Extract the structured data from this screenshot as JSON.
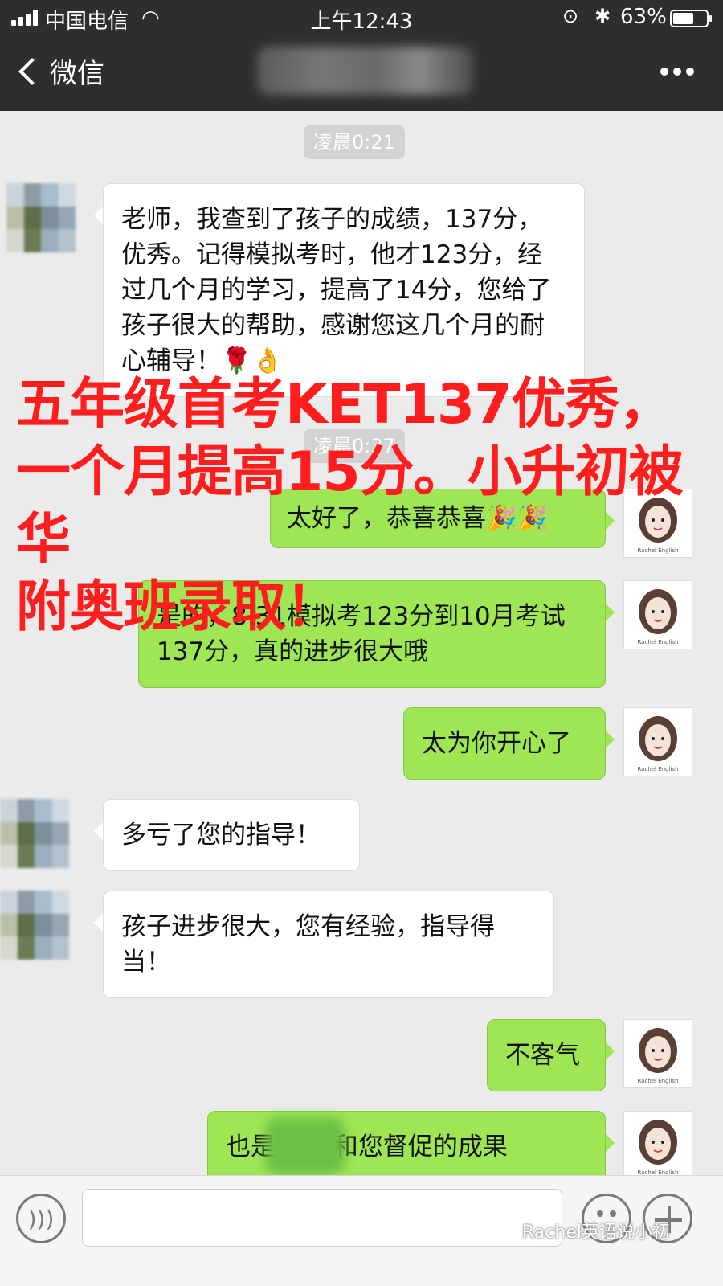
{
  "status_bar": {
    "carrier": "中国电信",
    "time": "上午12:43",
    "battery_percent_label": "63%",
    "battery_level": 0.63,
    "icons": [
      "signal-icon",
      "wifi-icon",
      "orientation-lock-icon",
      "bluetooth-icon",
      "battery-icon"
    ]
  },
  "nav": {
    "back_label": "微信",
    "more_icon": "more-icon"
  },
  "chat": {
    "timestamps": [
      "凌晨0:21",
      "凌晨0:37"
    ],
    "messages": [
      {
        "side": "left",
        "text": "老师，我查到了孩子的成绩，137分，优秀。记得模拟考时，他才123分，经过几个月的学习，提高了14分，您给了孩子很大的帮助，感谢您这几个月的耐心辅导！🌹👌"
      },
      {
        "side": "right",
        "text": "太好了，恭喜恭喜🎉🎉"
      },
      {
        "side": "right",
        "text": "是的，8.31模拟考123分到10月考试137分，真的进步很大哦"
      },
      {
        "side": "right",
        "text": "太为你开心了"
      },
      {
        "side": "left",
        "text": "多亏了您的指导！"
      },
      {
        "side": "left",
        "text": "孩子进步很大，您有经验，指导得当！"
      },
      {
        "side": "right",
        "text": "不客气"
      },
      {
        "side": "right",
        "text": "也是      努力和您督促的成果"
      }
    ]
  },
  "overlay_text": "五年级首考KET137优秀，\n一个月提高15分。小升初被华\n附奥班录取！",
  "input_bar": {
    "icons": [
      "voice-icon",
      "emoji-icon",
      "plus-icon"
    ]
  },
  "watermark": "Rachel英语说小初",
  "colors": {
    "nav_bg": "#2e2e2e",
    "chat_bg": "#ebebeb",
    "sent_bubble": "#9ee654",
    "received_bubble": "#ffffff",
    "overlay_red": "#ff1d1d"
  }
}
